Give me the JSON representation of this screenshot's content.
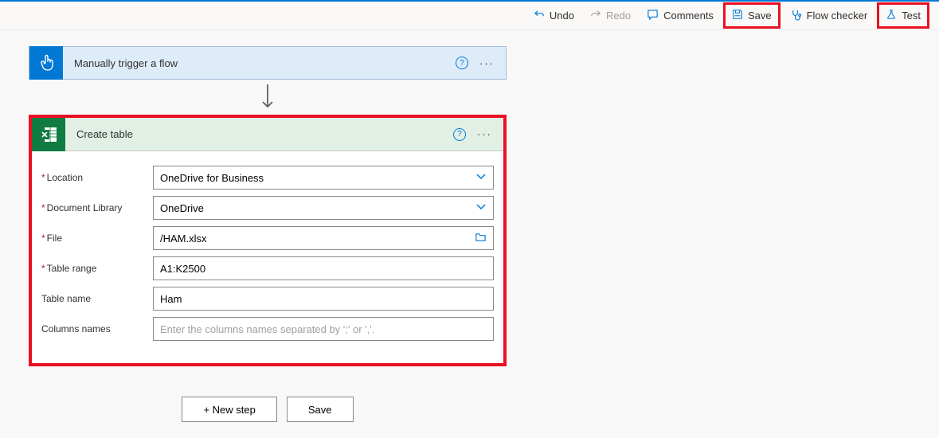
{
  "toolbar": {
    "undo": "Undo",
    "redo": "Redo",
    "comments": "Comments",
    "save": "Save",
    "flow_checker": "Flow checker",
    "test": "Test"
  },
  "trigger": {
    "title": "Manually trigger a flow"
  },
  "action": {
    "title": "Create table",
    "fields": {
      "location": {
        "label": "Location",
        "value": "OneDrive for Business"
      },
      "library": {
        "label": "Document Library",
        "value": "OneDrive"
      },
      "file": {
        "label": "File",
        "value": "/HAM.xlsx"
      },
      "range": {
        "label": "Table range",
        "value": "A1:K2500"
      },
      "name": {
        "label": "Table name",
        "value": "Ham"
      },
      "columns": {
        "label": "Columns names",
        "placeholder": "Enter the columns names separated by ';' or ','."
      }
    }
  },
  "buttons": {
    "new_step": "+ New step",
    "save": "Save"
  }
}
